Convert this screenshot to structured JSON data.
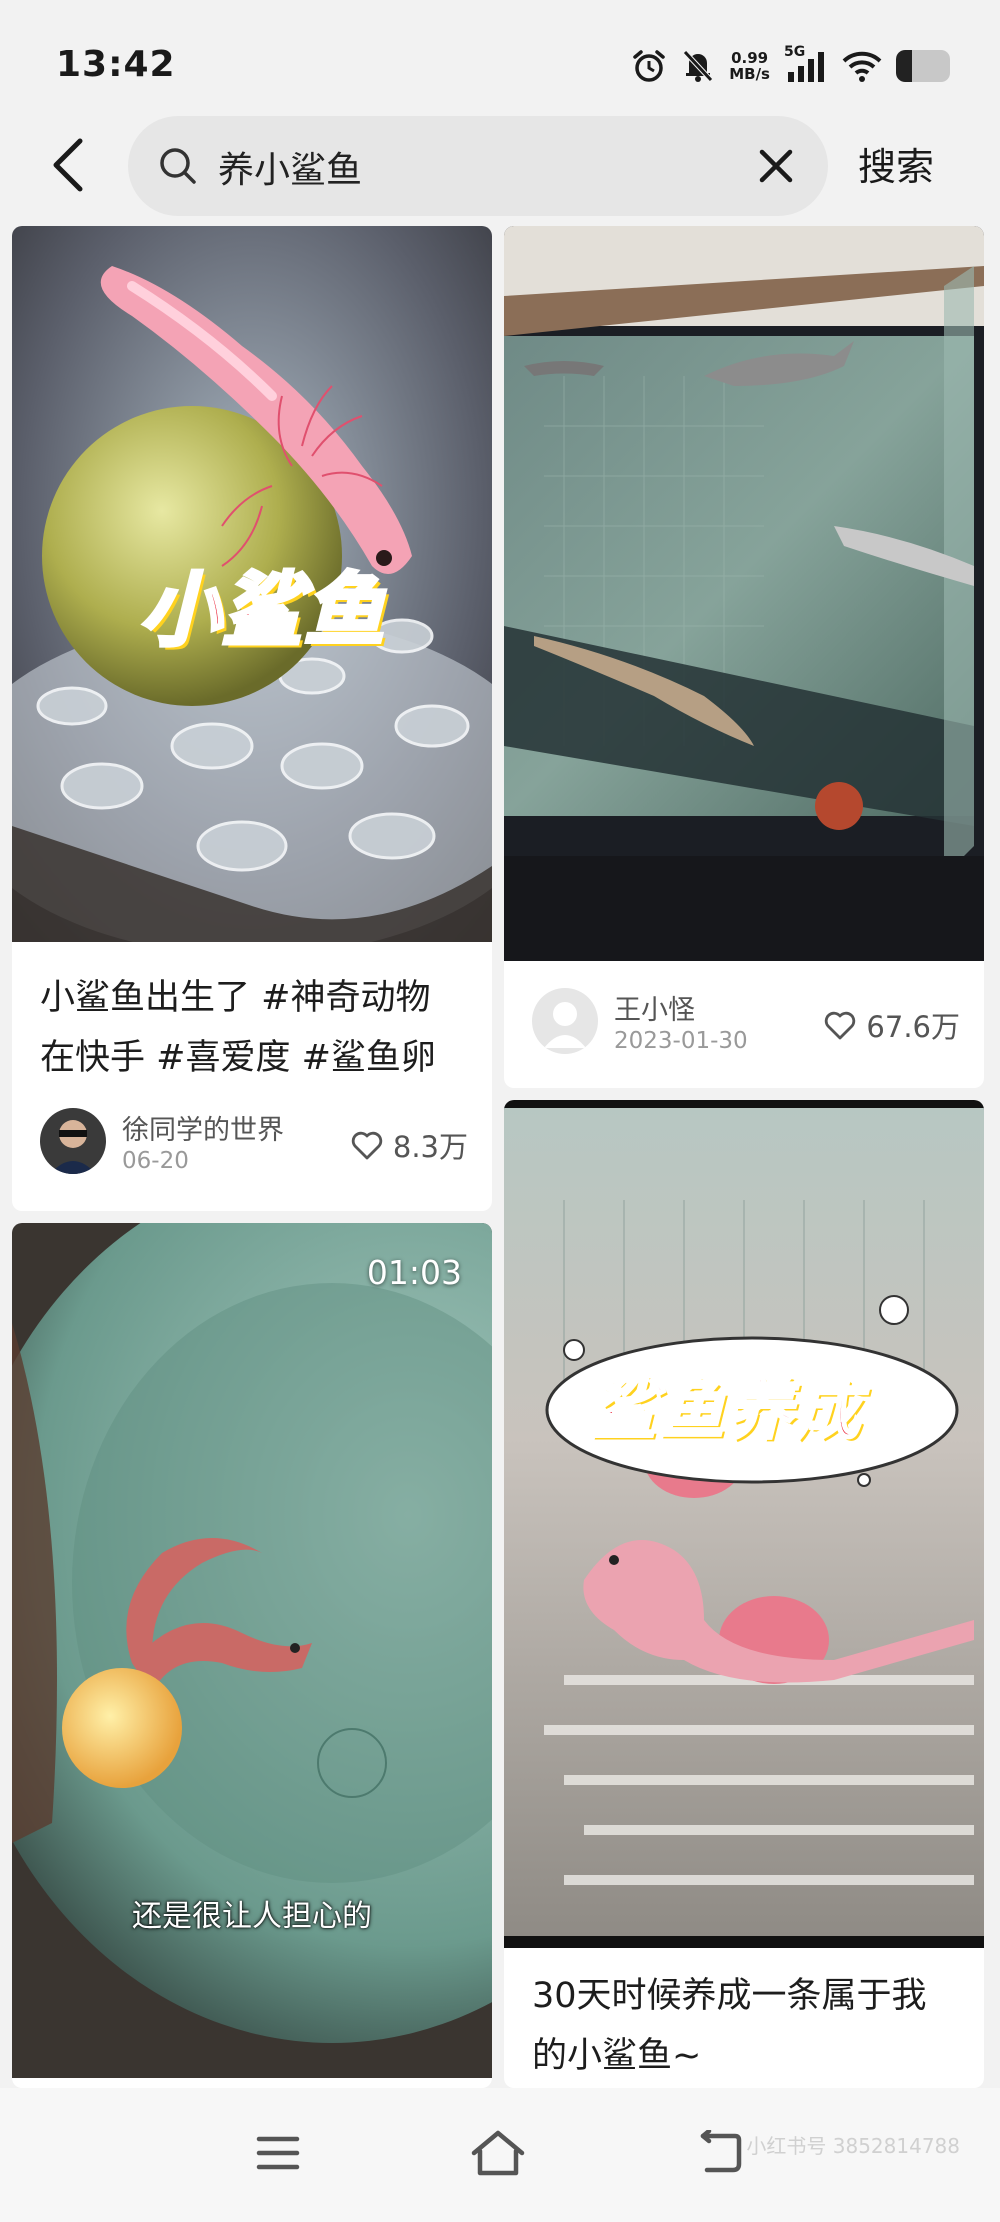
{
  "status_bar": {
    "time": "13:42",
    "net_speed_value": "0.99",
    "net_speed_unit": "MB/s",
    "network_type": "5G",
    "battery_level": 0.3,
    "icons": [
      "alarm-icon",
      "mute-icon",
      "signal-icon",
      "wifi-icon",
      "battery-icon"
    ]
  },
  "search": {
    "query": "养小鲨鱼",
    "submit_label": "搜索"
  },
  "cards": [
    {
      "overlay_text": "小鲨鱼",
      "title": "小鲨鱼出生了 #神奇动物在快手 #喜爱度 #鲨鱼卵",
      "author": "徐同学的世界",
      "date": "06-20",
      "likes": "8.3万"
    },
    {
      "author": "王小怪",
      "date": "2023-01-30",
      "likes": "67.6万"
    },
    {
      "duration": "01:03",
      "subtitle": "还是很让人担心的"
    },
    {
      "overlay_text": "鲨鱼养成",
      "title": "30天时候养成一条属于我的小鲨鱼~"
    }
  ],
  "nav": {
    "icons": [
      "menu-icon",
      "home-icon",
      "back-nav-icon"
    ]
  },
  "watermark": "小红书号 3852814788",
  "colors": {
    "background": "#f2f2f2",
    "card": "#ffffff",
    "overlay_red": "#e8162c",
    "overlay_yellow": "#ffd21f"
  }
}
